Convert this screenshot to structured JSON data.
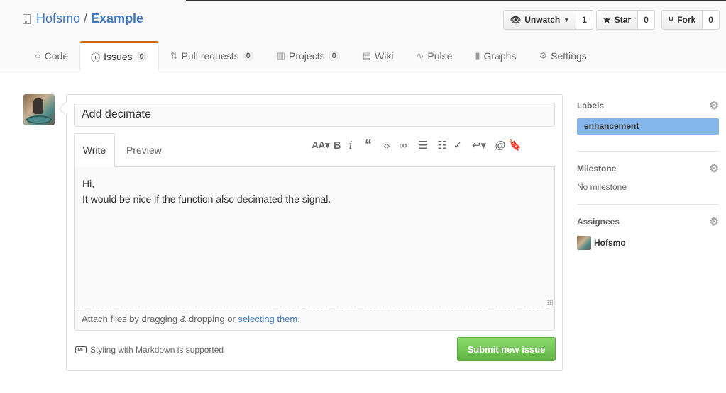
{
  "repo": {
    "owner": "Hofsmo",
    "separator": "/",
    "name": "Example"
  },
  "actions": {
    "unwatch": {
      "label": "Unwatch",
      "count": "1"
    },
    "star": {
      "label": "Star",
      "count": "0"
    },
    "fork": {
      "label": "Fork",
      "count": "0"
    }
  },
  "tabs": [
    {
      "label": "Code",
      "icon": "code-icon",
      "badge": ""
    },
    {
      "label": "Issues",
      "icon": "issue-opened-icon",
      "badge": "0",
      "selected": true
    },
    {
      "label": "Pull requests",
      "icon": "git-pull-request-icon",
      "badge": "0"
    },
    {
      "label": "Projects",
      "icon": "project-icon",
      "badge": "0"
    },
    {
      "label": "Wiki",
      "icon": "book-icon",
      "badge": ""
    },
    {
      "label": "Pulse",
      "icon": "pulse-icon",
      "badge": ""
    },
    {
      "label": "Graphs",
      "icon": "graph-icon",
      "badge": ""
    },
    {
      "label": "Settings",
      "icon": "gear-icon",
      "badge": ""
    }
  ],
  "form": {
    "title_value": "Add decimate",
    "write_tab": "Write",
    "preview_tab": "Preview",
    "body_text": "Hi,\nIt would be nice if the function also decimated the signal.",
    "attach_prefix": "Attach files by dragging & dropping or ",
    "attach_link": "selecting them",
    "attach_suffix": ".",
    "markdown_note": "Styling with Markdown is supported",
    "submit_label": "Submit new issue"
  },
  "sidebar": {
    "labels": {
      "heading": "Labels",
      "items": [
        "enhancement"
      ],
      "label_color": "#84b6eb"
    },
    "milestone": {
      "heading": "Milestone",
      "value": "No milestone"
    },
    "assignees": {
      "heading": "Assignees",
      "items": [
        "Hofsmo"
      ]
    }
  },
  "colors": {
    "link": "#4078c0",
    "selected_tab_accent": "#d26911",
    "submit_green": "#60b044"
  }
}
